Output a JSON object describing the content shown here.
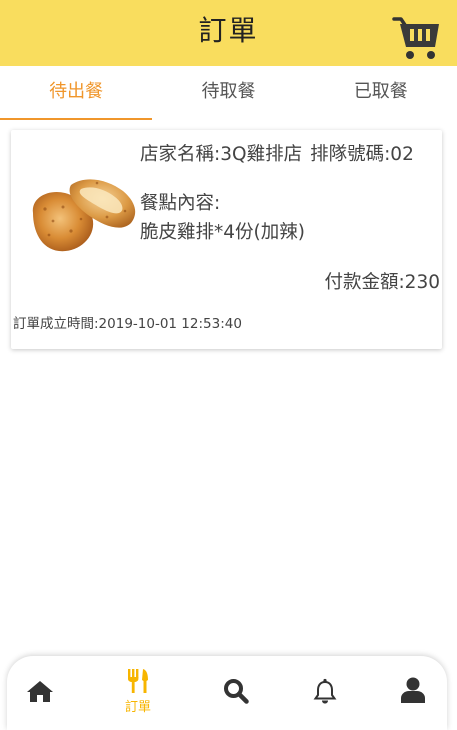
{
  "header": {
    "title": "訂單",
    "cart_icon": "shopping-cart-icon",
    "bg_color": "#f9dd5e"
  },
  "tabs": [
    {
      "label": "待出餐",
      "active": true
    },
    {
      "label": "待取餐",
      "active": false
    },
    {
      "label": "已取餐",
      "active": false
    }
  ],
  "accent_color": "#f0962b",
  "order": {
    "store": "店家名稱:3Q雞排店",
    "queue": "排隊號碼:02",
    "meal_label": "餐點內容:",
    "meal_content": "脆皮雞排*4份(加辣)",
    "price": "付款金額:230",
    "created_time": "訂單成立時間:2019-10-01 12:53:40",
    "image": "fried-chicken-image"
  },
  "bottom_nav": [
    {
      "icon": "home-icon",
      "label": "",
      "active": false
    },
    {
      "icon": "fork-knife-icon",
      "label": "訂單",
      "active": true
    },
    {
      "icon": "search-icon",
      "label": "",
      "active": false
    },
    {
      "icon": "bell-icon",
      "label": "",
      "active": false
    },
    {
      "icon": "user-icon",
      "label": "",
      "active": false
    }
  ],
  "nav_active_color": "#f7b500"
}
